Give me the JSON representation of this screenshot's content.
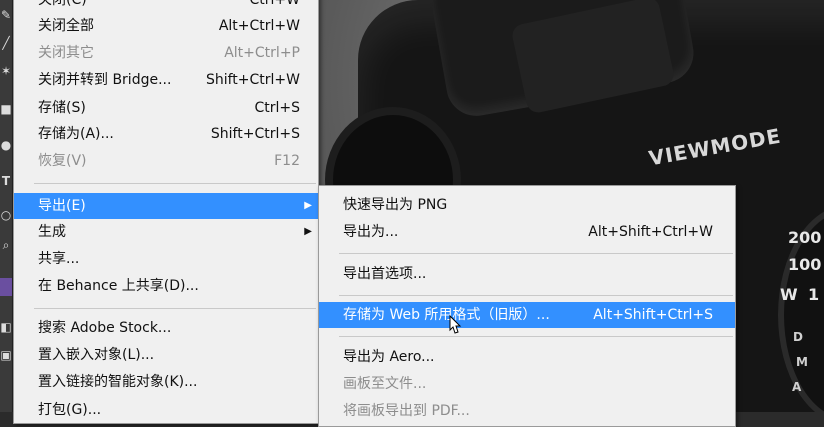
{
  "photo": {
    "brand_text": "VIEWMODE",
    "dial_numbers": [
      "200",
      "100",
      "W",
      "1"
    ],
    "dial_marks": [
      "D",
      "M",
      "A"
    ]
  },
  "file_menu": {
    "items": [
      {
        "label": "关闭(C)",
        "shortcut": "Ctrl+W",
        "disabled": false
      },
      {
        "label": "关闭全部",
        "shortcut": "Alt+Ctrl+W",
        "disabled": false
      },
      {
        "label": "关闭其它",
        "shortcut": "Alt+Ctrl+P",
        "disabled": true
      },
      {
        "label": "关闭并转到 Bridge...",
        "shortcut": "Shift+Ctrl+W",
        "disabled": false
      },
      {
        "label": "存储(S)",
        "shortcut": "Ctrl+S",
        "disabled": false
      },
      {
        "label": "存储为(A)...",
        "shortcut": "Shift+Ctrl+S",
        "disabled": false
      },
      {
        "label": "恢复(V)",
        "shortcut": "F12",
        "disabled": true
      },
      {
        "label": "导出(E)",
        "shortcut": "",
        "disabled": false,
        "highlighted": true
      },
      {
        "label": "生成",
        "shortcut": "",
        "disabled": false
      },
      {
        "label": "共享...",
        "shortcut": "",
        "disabled": false
      },
      {
        "label": "在 Behance 上共享(D)...",
        "shortcut": "",
        "disabled": false
      },
      {
        "label": "搜索 Adobe Stock...",
        "shortcut": "",
        "disabled": false
      },
      {
        "label": "置入嵌入对象(L)...",
        "shortcut": "",
        "disabled": false
      },
      {
        "label": "置入链接的智能对象(K)...",
        "shortcut": "",
        "disabled": false
      },
      {
        "label": "打包(G)...",
        "shortcut": "",
        "disabled": false
      }
    ]
  },
  "export_menu": {
    "items": [
      {
        "label": "快速导出为 PNG",
        "shortcut": "",
        "disabled": false
      },
      {
        "label": "导出为...",
        "shortcut": "Alt+Shift+Ctrl+W",
        "disabled": false
      },
      {
        "label": "导出首选项...",
        "shortcut": "",
        "disabled": false
      },
      {
        "label": "存储为 Web 所用格式（旧版）...",
        "shortcut": "Alt+Shift+Ctrl+S",
        "disabled": false,
        "highlighted": true
      },
      {
        "label": "导出为 Aero...",
        "shortcut": "",
        "disabled": false
      },
      {
        "label": "画板至文件...",
        "shortcut": "",
        "disabled": true
      },
      {
        "label": "将画板导出到 PDF...",
        "shortcut": "",
        "disabled": true
      }
    ]
  },
  "colors": {
    "menu_bg": "#f0f0f0",
    "highlight": "#3390ff",
    "disabled_text": "#8d8d8d"
  }
}
